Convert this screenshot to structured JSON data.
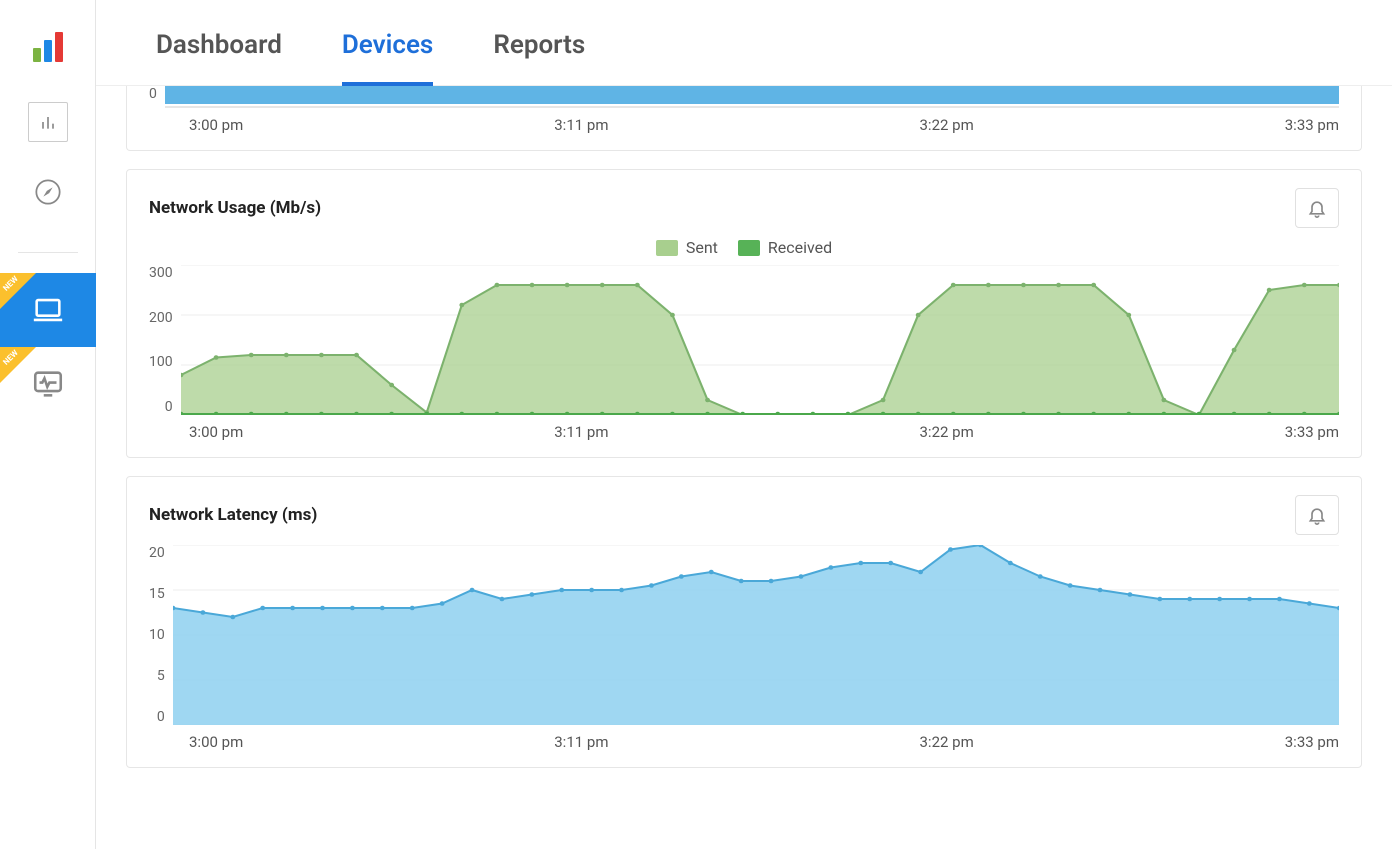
{
  "tabs": {
    "dashboard": "Dashboard",
    "devices": "Devices",
    "reports": "Reports",
    "active": "devices"
  },
  "sidebar": {
    "newTag": "NEW"
  },
  "timeTicks": [
    "3:00 pm",
    "3:11 pm",
    "3:22 pm",
    "3:33 pm"
  ],
  "charts": {
    "top": {
      "yTicks": [
        "0"
      ],
      "chart_data": {
        "type": "bar",
        "categories": [
          "3:00 pm",
          "3:11 pm",
          "3:22 pm",
          "3:33 pm"
        ],
        "values": [
          0
        ],
        "xlabel": "",
        "ylabel": "",
        "ylim": [
          0,
          0
        ],
        "note": "Only bottom strip of a larger chart is visible; a blue bar spans the full width at baseline."
      }
    },
    "network": {
      "title": "Network Usage (Mb/s)",
      "legend": {
        "sent": "Sent",
        "received": "Received"
      },
      "colors": {
        "sent": "#a8cf8e",
        "received": "#57b257"
      },
      "yTicks": [
        "300",
        "200",
        "100",
        "0"
      ],
      "chart_data": {
        "type": "area",
        "x": [
          0,
          1,
          2,
          3,
          4,
          5,
          6,
          7,
          8,
          9,
          10,
          11,
          12,
          13,
          14,
          15,
          16,
          17,
          18,
          19,
          20,
          21,
          22,
          23,
          24,
          25,
          26,
          27,
          28,
          29,
          30,
          31,
          32,
          33
        ],
        "series": [
          {
            "name": "Sent",
            "values": [
              80,
              115,
              120,
              120,
              120,
              120,
              60,
              5,
              220,
              260,
              260,
              260,
              260,
              260,
              200,
              30,
              0,
              0,
              0,
              0,
              30,
              200,
              260,
              260,
              260,
              260,
              260,
              200,
              30,
              0,
              130,
              250,
              260,
              260
            ]
          },
          {
            "name": "Received",
            "values": [
              2,
              2,
              2,
              2,
              2,
              2,
              2,
              2,
              2,
              2,
              2,
              2,
              2,
              2,
              2,
              2,
              2,
              2,
              2,
              2,
              2,
              2,
              2,
              2,
              2,
              2,
              2,
              2,
              2,
              2,
              2,
              2,
              2,
              2
            ]
          }
        ],
        "xlabel": "",
        "ylabel": "Mb/s",
        "ylim": [
          0,
          300
        ],
        "xTicks": [
          "3:00 pm",
          "3:11 pm",
          "3:22 pm",
          "3:33 pm"
        ]
      }
    },
    "latency": {
      "title": "Network Latency (ms)",
      "yTicks": [
        "20",
        "15",
        "10",
        "5",
        "0"
      ],
      "chart_data": {
        "type": "area",
        "x": [
          0,
          1,
          2,
          3,
          4,
          5,
          6,
          7,
          8,
          9,
          10,
          11,
          12,
          13,
          14,
          15,
          16,
          17,
          18,
          19,
          20,
          21,
          22,
          23,
          24,
          25,
          26,
          27,
          28,
          29,
          30,
          31,
          32,
          33
        ],
        "series": [
          {
            "name": "Latency",
            "values": [
              13,
              12.5,
              12,
              13,
              13,
              13,
              13,
              13,
              13,
              13.5,
              15,
              14,
              14.5,
              15,
              15,
              15,
              15.5,
              16.5,
              17,
              16,
              16,
              16.5,
              17.5,
              18,
              18,
              17,
              19.5,
              20,
              18,
              16.5,
              15.5,
              15,
              14.5,
              14,
              14,
              14,
              14,
              14,
              13.5,
              13
            ]
          }
        ],
        "xlabel": "",
        "ylabel": "ms",
        "ylim": [
          0,
          20
        ],
        "xTicks": [
          "3:00 pm",
          "3:11 pm",
          "3:22 pm",
          "3:33 pm"
        ],
        "color": "#8ed0f0"
      }
    }
  }
}
